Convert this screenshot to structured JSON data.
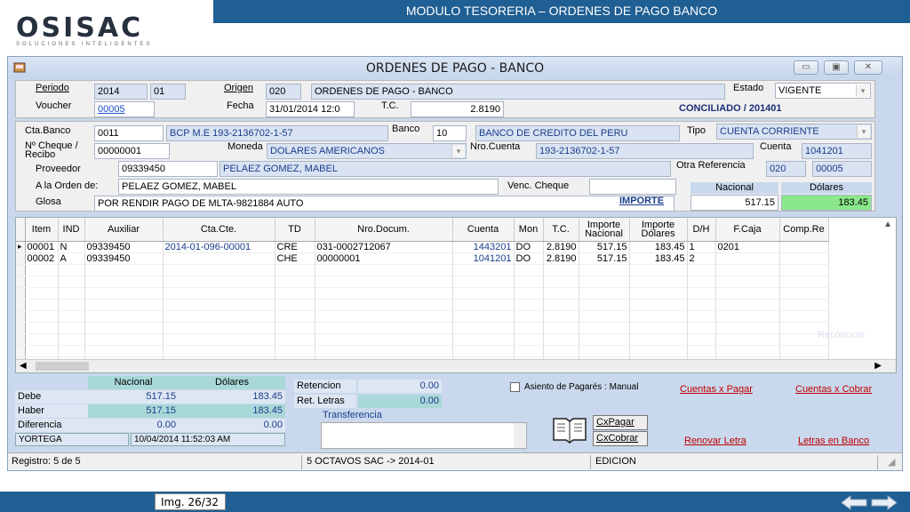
{
  "slide": {
    "title": "MODULO TESORERIA – ORDENES DE PAGO BANCO",
    "logo_text": "OSISAC",
    "logo_tagline": "SOLUCIONES INTELIGENTES",
    "image_counter": "Img. 26/32"
  },
  "window": {
    "title": "ORDENES DE PAGO - BANCO"
  },
  "header": {
    "periodo_label": "Periodo",
    "periodo_year": "2014",
    "periodo_month": "01",
    "origen_label": "Origen",
    "origen_code": "020",
    "origen_desc": "ORDENES DE PAGO - BANCO",
    "estado_label": "Estado",
    "estado_value": "VIGENTE",
    "voucher_label": "Voucher",
    "voucher_value": "00005",
    "fecha_label": "Fecha",
    "fecha_value": "31/01/2014 12:0",
    "tc_label": "T.C.",
    "tc_value": "2.8190",
    "conciliado": "CONCILIADO / 201401"
  },
  "bank": {
    "ctabanco_label": "Cta.Banco",
    "ctabanco_value": "0011",
    "ctabanco_desc": "BCP M.E 193-2136702-1-57",
    "banco_label": "Banco",
    "banco_code": "10",
    "banco_desc": "BANCO DE CREDITO DEL PERU",
    "tipo_label": "Tipo",
    "tipo_value": "CUENTA CORRIENTE",
    "cheque_label": "Nº Cheque / Recibo",
    "cheque_value": "00000001",
    "moneda_label": "Moneda",
    "moneda_value": "DOLARES AMERICANOS",
    "nrocuenta_label": "Nro.Cuenta",
    "nrocuenta_value": "193-2136702-1-57",
    "cuenta_label": "Cuenta",
    "cuenta_value": "1041201",
    "proveedor_label": "Proveedor",
    "proveedor_code": "09339450",
    "proveedor_name": "PELAEZ GOMEZ, MABEL",
    "otraref_label": "Otra Referencia",
    "otraref_a": "020",
    "otraref_b": "00005",
    "orden_label": "A la Orden de:",
    "orden_value": "PELAEZ GOMEZ, MABEL",
    "venc_label": "Venc. Cheque",
    "venc_value": "",
    "nacional_label": "Nacional",
    "dolares_label": "Dólares",
    "glosa_label": "Glosa",
    "glosa_value": "POR RENDIR PAGO DE MLTA-9821884 AUTO",
    "importe_label": "IMPORTE",
    "importe_nacional": "517.15",
    "importe_dolares": "183.45"
  },
  "grid": {
    "columns": [
      "Item",
      "IND",
      "Auxiliar",
      "Cta.Cte.",
      "TD",
      "Nro.Docum.",
      "Cuenta",
      "Mon",
      "T.C.",
      "Importe Nacional",
      "Importe Dólares",
      "D/H",
      "F.Caja",
      "Comp.Re"
    ],
    "rows": [
      [
        "00001",
        "N",
        "09339450",
        "2014-01-096-00001",
        "CRE",
        "031-0002712067",
        "1443201",
        "DO",
        "2.8190",
        "517.15",
        "183.45",
        "1",
        "0201",
        ""
      ],
      [
        "00002",
        "A",
        "09339450",
        "",
        "CHE",
        "00000001",
        "1041201",
        "DO",
        "2.8190",
        "517.15",
        "183.45",
        "2",
        "",
        ""
      ]
    ],
    "watermark": "Reconocer"
  },
  "totals": {
    "nacional_label": "Nacional",
    "dolares_label": "Dólares",
    "debe_label": "Debe",
    "debe_nacional": "517.15",
    "debe_dolares": "183.45",
    "haber_label": "Haber",
    "haber_nacional": "517.15",
    "haber_dolares": "183.45",
    "diferencia_label": "Diferencia",
    "dif_nacional": "0.00",
    "dif_dolares": "0.00",
    "user": "YORTEGA",
    "timestamp": "10/04/2014 11:52:03 AM"
  },
  "retentions": {
    "retencion_label": "Retencion",
    "retencion_value": "0.00",
    "retletras_label": "Ret. Letras",
    "retletras_value": "0.00",
    "transferencia_label": "Transferencia"
  },
  "actions": {
    "asiento_label": "Asiento de Pagarés : Manual",
    "cuentas_pagar": "Cuentas x Pagar",
    "cuentas_cobrar": "Cuentas x Cobrar",
    "cxpagar_btn": "CxPagar",
    "cxcobrar_btn": "CxCobrar",
    "renovar_letra": "Renovar Letra",
    "letras_banco": "Letras en Banco"
  },
  "status": {
    "registro": "Registro: 5 de 5",
    "company": "5 OCTAVOS SAC -> 2014-01",
    "mode": "EDICION"
  },
  "colors": {
    "header_bar": "#1f5f93",
    "dolares_highlight": "#8ae88a",
    "teal_cell": "#a9d8d8"
  }
}
